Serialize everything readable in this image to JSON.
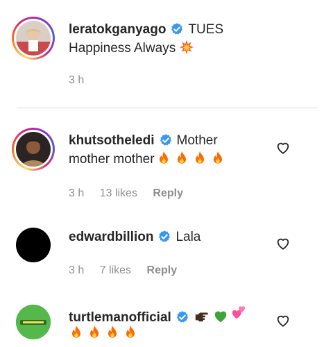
{
  "caption": {
    "username": "leratokganyago",
    "text_line1": "TUES",
    "text_line2": "Happiness Always",
    "text_line2_emoji": "collision",
    "time": "3 h"
  },
  "comments": [
    {
      "username": "khutsotheledi",
      "text_line1": "Mother",
      "text_line2": "mother mother",
      "emojis": [
        "fire",
        "fire",
        "fire",
        "fire"
      ],
      "time": "3 h",
      "likes": "13 likes",
      "reply": "Reply"
    },
    {
      "username": "edwardbillion",
      "text_line1": "Lala",
      "time": "3 h",
      "likes": "7 likes",
      "reply": "Reply"
    },
    {
      "username": "turtlemanofficial",
      "emojis_line1": [
        "backhand-index-pointing-right-dark",
        "green-heart",
        "two-hearts"
      ],
      "emojis_line2": [
        "fire",
        "fire",
        "fire",
        "fire"
      ]
    }
  ],
  "colors": {
    "verified_blue": "#3897f0",
    "fire_orange": "#ff6a00",
    "meta_gray": "#8e8e8e",
    "avatar_black": "#000000",
    "avatar_green": "#4caf50"
  },
  "icons": {
    "verified": "verified-badge-icon",
    "like": "heart-outline-icon"
  }
}
